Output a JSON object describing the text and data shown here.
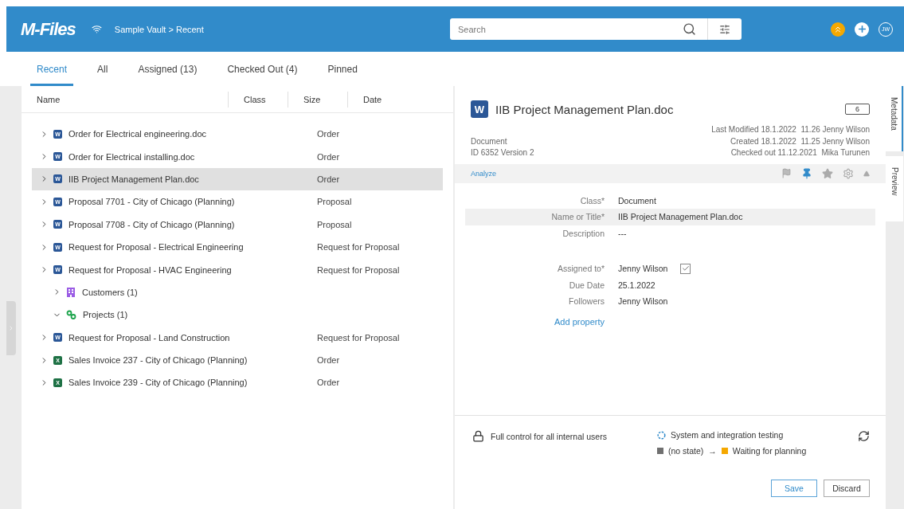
{
  "header": {
    "logo": "M-Files",
    "breadcrumb": "Sample Vault > Recent",
    "search": {
      "placeholder": "Search"
    },
    "avatar": "JW"
  },
  "tabs": [
    {
      "label": "Recent",
      "selected": true
    },
    {
      "label": "All",
      "selected": false
    },
    {
      "label": "Assigned (13)",
      "selected": false
    },
    {
      "label": "Checked Out (4)",
      "selected": false
    },
    {
      "label": "Pinned",
      "selected": false
    }
  ],
  "list": {
    "columns": [
      "Name",
      "Class",
      "Size",
      "Date"
    ],
    "rows": [
      {
        "name": "Order for Electrical engineering.doc",
        "class": "Order",
        "kind": "word",
        "icon": "W",
        "expanded": false,
        "selected": false
      },
      {
        "name": "Order for Electrical installing.doc",
        "class": "Order",
        "kind": "word",
        "icon": "W",
        "expanded": false,
        "selected": false
      },
      {
        "name": "IIB Project Management Plan.doc",
        "class": "Order",
        "kind": "word",
        "icon": "W",
        "expanded": false,
        "selected": true
      },
      {
        "name": "Proposal 7701 - City of Chicago (Planning)",
        "class": "Proposal",
        "kind": "word",
        "icon": "W",
        "expanded": false,
        "selected": false
      },
      {
        "name": "Proposal 7708 - City of Chicago (Planning)",
        "class": "Proposal",
        "kind": "word",
        "icon": "W",
        "expanded": false,
        "selected": false
      },
      {
        "name": "Request for Proposal - Electrical Engineering",
        "class": "Request for Proposal",
        "kind": "word",
        "icon": "W",
        "expanded": false,
        "selected": false
      },
      {
        "name": "Request for Proposal - HVAC Engineering",
        "class": "Request for Proposal",
        "kind": "word",
        "icon": "W",
        "expanded": false,
        "selected": false,
        "children": [
          {
            "name": "Customers (1)",
            "kind": "customers",
            "expanded": false,
            "selected": false
          },
          {
            "name": "Projects (1)",
            "kind": "projects",
            "expanded": true,
            "selected": false
          }
        ]
      },
      {
        "name": "Request for Proposal - Land Construction",
        "class": "Request for Proposal",
        "kind": "word",
        "icon": "W",
        "expanded": false,
        "selected": false
      },
      {
        "name": "Sales Invoice 237 - City of Chicago (Planning)",
        "class": "Order",
        "kind": "excel",
        "icon": "X",
        "expanded": false,
        "selected": false
      },
      {
        "name": "Sales Invoice 239 - City of Chicago (Planning)",
        "class": "Order",
        "kind": "excel",
        "icon": "X",
        "expanded": false,
        "selected": false
      }
    ]
  },
  "details": {
    "icon_letter": "W",
    "title": "IIB Project Management Plan.doc",
    "comments": "6",
    "type": "Document",
    "id": "ID 6352 Version 2",
    "history": [
      "Last Modified 18.1.2022  11.26 Jenny Wilson",
      "Created 18.1.2022  11.25 Jenny Wilson",
      "Checked out 11.12.2021  Mika Turunen"
    ],
    "analyze": "Analyze",
    "property_groups": [
      {
        "properties": [
          {
            "label": "Class*",
            "value": "Document",
            "selected": false
          },
          {
            "label": "Name or Title*",
            "value": "IIB Project Management Plan.doc",
            "selected": true
          },
          {
            "label": "Description",
            "value": "---",
            "selected": false
          }
        ]
      },
      {
        "properties": [
          {
            "label": "Assigned to*",
            "value": "Jenny Wilson",
            "selected": false,
            "checked": true
          },
          {
            "label": "Due Date",
            "value": "25.1.2022",
            "selected": false
          },
          {
            "label": "Followers",
            "value": "Jenny Wilson",
            "selected": false
          }
        ]
      }
    ],
    "add_property": "Add property",
    "permissions": "Full control for all internal users",
    "workflow": "System and integration testing",
    "states": [
      {
        "label": "(no state)",
        "color": "#707070"
      },
      {
        "label": "Waiting for planning",
        "color": "#f5a800"
      }
    ],
    "arrow": "→",
    "buttons": [
      "Save",
      "Discard"
    ]
  },
  "side_tabs": [
    {
      "label": "Metadata",
      "selected": true
    },
    {
      "label": "Preview",
      "selected": false
    }
  ]
}
